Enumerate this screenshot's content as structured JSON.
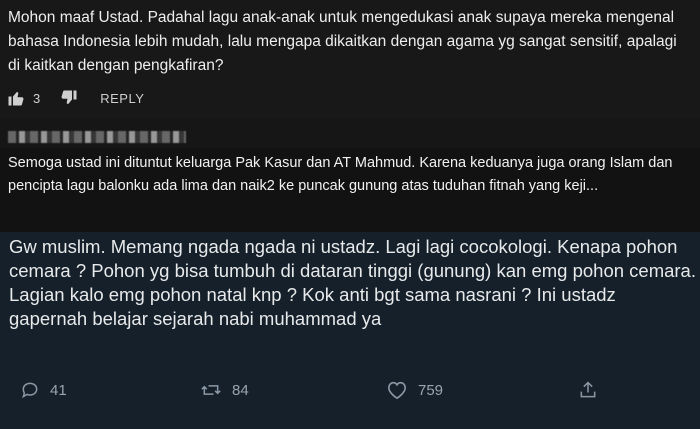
{
  "comment1": {
    "text": "Mohon maaf Ustad. Padahal lagu anak-anak untuk mengedukasi anak supaya mereka mengenal bahasa Indonesia lebih mudah, lalu mengapa dikaitkan dengan agama yg sangat sensitif, apalagi di kaitkan dengan pengkafiran?",
    "likes": "3",
    "reply_label": "REPLY",
    "icons": [
      "thumbs-up-icon",
      "thumbs-down-icon"
    ]
  },
  "comment2": {
    "text": "Semoga ustad ini dituntut keluarga Pak Kasur dan AT Mahmud. Karena keduanya juga orang Islam dan pencipta lagu balonku ada lima dan naik2 ke puncak gunung atas tuduhan fitnah yang keji..."
  },
  "tweet": {
    "text": "Gw muslim. Memang ngada ngada ni ustadz. Lagi lagi cocokologi. Kenapa pohon cemara ? Pohon yg bisa tumbuh di dataran tinggi (gunung) kan emg pohon cemara. Lagian kalo emg pohon natal knp ? Kok anti bgt sama nasrani ? Ini ustadz gapernah belajar sejarah nabi muhammad ya",
    "replies": "41",
    "retweets": "84",
    "likes": "759",
    "icons": [
      "reply-icon",
      "retweet-icon",
      "like-icon",
      "share-icon"
    ]
  },
  "colors": {
    "youtube_bg": "#181818",
    "instagram_bg": "#121212",
    "twitter_bg": "#15202b",
    "twitter_icon": "#8b98a5"
  }
}
